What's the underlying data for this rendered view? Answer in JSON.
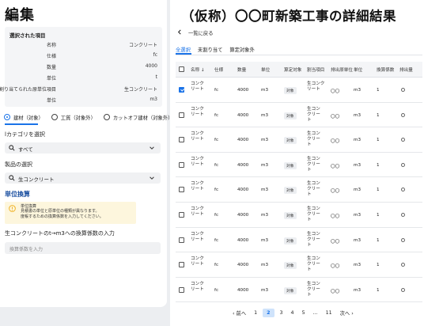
{
  "left": {
    "title": "編集",
    "selected_box": {
      "title": "選択された項目",
      "rows": [
        {
          "key": "名称",
          "value": "コンクリート"
        },
        {
          "key": "仕様",
          "value": "fc"
        },
        {
          "key": "数量",
          "value": "4000"
        },
        {
          "key": "単位",
          "value": "t"
        },
        {
          "key": "割り当てられた原単位項目",
          "value": "生コンクリート"
        },
        {
          "key": "単位",
          "value": "m3"
        }
      ]
    },
    "radios": [
      {
        "label": "建材（対象）",
        "selected": true
      },
      {
        "label": "工質（対象外）",
        "selected": false
      },
      {
        "label": "カットオフ建材（対象外）",
        "selected": false
      }
    ],
    "category_label": "lカテゴリを選択",
    "category_value": "すべて",
    "product_label": "製品の選択",
    "product_value": "生コンクリート",
    "unit_section_title": "単位換算",
    "warning": {
      "line1": "単位換算",
      "line2": "見積書の単位と原単位の種類が異なります。",
      "line3": "度帳するための換算係数を入力してください。"
    },
    "factor_label": "生コンクリートのt→m3への換算係数の入力",
    "factor_placeholder": "換算係数を入力"
  },
  "right": {
    "title": "（仮称）〇〇町新築工事の詳細結果",
    "back_label": "一覧に戻る",
    "tabs": [
      "全選択",
      "未割り当て",
      "算定対象外"
    ],
    "columns": [
      "名称",
      "仕様",
      "数量",
      "単位",
      "算定対象",
      "割当項目",
      "排出原単位",
      "単位",
      "換算係数",
      "排出量"
    ],
    "sort_icon": "arrow-down",
    "rows": [
      {
        "checked": true,
        "name": "コンク\nリート",
        "spec": "fc",
        "qty": "4000",
        "unit": "m3",
        "target": "対象",
        "assigned": "生コンク\nリート",
        "factor_unit_src": "〇〇",
        "unit2": "m3",
        "conv": "1",
        "emission_icon": "circle"
      },
      {
        "checked": false,
        "name": "コンク\nリート",
        "spec": "fc",
        "qty": "4000",
        "unit": "m3",
        "target": "対象",
        "assigned": "生コン\nクリー\nト",
        "factor_unit_src": "〇〇",
        "unit2": "m3",
        "conv": "1",
        "emission_icon": "circle"
      },
      {
        "checked": false,
        "name": "コンク\nリート",
        "spec": "fc",
        "qty": "4000",
        "unit": "m3",
        "target": "対象",
        "assigned": "生コン\nクリー\nト",
        "factor_unit_src": "〇〇",
        "unit2": "m3",
        "conv": "1",
        "emission_icon": "circle"
      },
      {
        "checked": false,
        "name": "コンク\nリート",
        "spec": "fc",
        "qty": "4000",
        "unit": "m3",
        "target": "対象",
        "assigned": "生コン\nクリー\nト",
        "factor_unit_src": "〇〇",
        "unit2": "m3",
        "conv": "1",
        "emission_icon": "circle"
      },
      {
        "checked": false,
        "name": "コンク\nリート",
        "spec": "fc",
        "qty": "4000",
        "unit": "m3",
        "target": "対象",
        "assigned": "生コン\nクリー\nト",
        "factor_unit_src": "〇〇",
        "unit2": "m3",
        "conv": "1",
        "emission_icon": "circle"
      },
      {
        "checked": false,
        "name": "コンク\nリート",
        "spec": "fc",
        "qty": "4000",
        "unit": "m3",
        "target": "対象",
        "assigned": "生コン\nクリー\nト",
        "factor_unit_src": "〇〇",
        "unit2": "m3",
        "conv": "1",
        "emission_icon": "circle"
      },
      {
        "checked": false,
        "name": "コンク\nリート",
        "spec": "fc",
        "qty": "4000",
        "unit": "m3",
        "target": "対象",
        "assigned": "生コン\nクリー\nト",
        "factor_unit_src": "〇〇",
        "unit2": "m3",
        "conv": "1",
        "emission_icon": "circle"
      },
      {
        "checked": false,
        "name": "コンク\nリート",
        "spec": "fc",
        "qty": "4000",
        "unit": "m3",
        "target": "対象",
        "assigned": "生コン\nクリー\nト",
        "factor_unit_src": "〇〇",
        "unit2": "m3",
        "conv": "1",
        "emission_icon": "circle"
      },
      {
        "checked": false,
        "name": "コンク\nリート",
        "spec": "fc",
        "qty": "4000",
        "unit": "m3",
        "target": "対象",
        "assigned": "生コン\nクリー\nト",
        "factor_unit_src": "〇〇",
        "unit2": "m3",
        "conv": "1",
        "emission_icon": "circle"
      }
    ],
    "pagination": {
      "prev": "前へ",
      "next": "次へ",
      "pages": [
        "1",
        "2",
        "3",
        "4",
        "5",
        "...",
        "11"
      ],
      "current": "2"
    }
  },
  "colors": {
    "accent": "#1a73e8",
    "section_title": "#1a4fa0",
    "warning_bg": "#fdf6dd",
    "warning_icon": "#f0b429"
  }
}
